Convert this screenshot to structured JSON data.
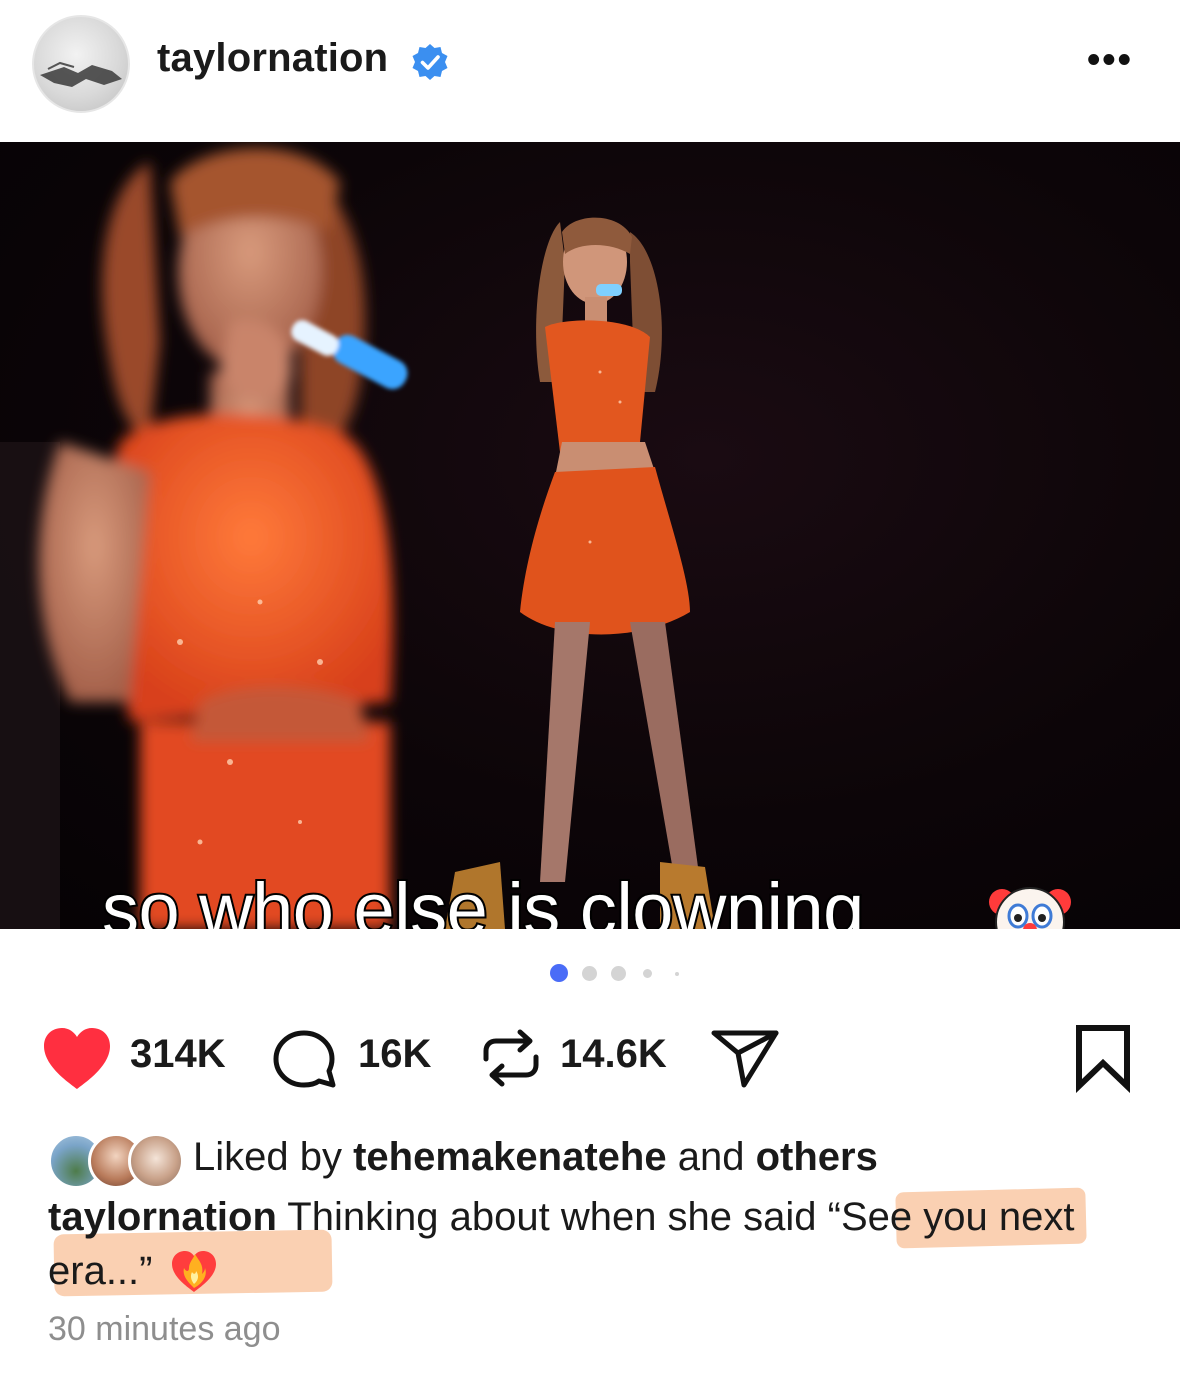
{
  "post": {
    "author": {
      "username": "taylornation",
      "verified": true,
      "avatar_icon": "avatar"
    },
    "more_icon": "more-icon",
    "more_label": "•••",
    "media": {
      "overlay_text": "so who else is clowning",
      "overlay_emoji": "clown-face-emoji",
      "carousel": {
        "total": 5,
        "active_index": 0
      }
    },
    "actions": {
      "like_count": "314K",
      "comment_count": "16K",
      "repost_count": "14.6K",
      "like_icon": "heart-icon",
      "comment_icon": "comment-icon",
      "repost_icon": "repost-icon",
      "share_icon": "share-icon",
      "save_icon": "bookmark-icon"
    },
    "likes": {
      "prefix": "Liked by ",
      "user": "tehemakenatehe",
      "middle": " and ",
      "others": "others"
    },
    "caption": {
      "username": "taylornation",
      "text_part1": " Thinking about when she said ",
      "text_highlight": "“See you next era...”",
      "emoji": "heart-on-fire-emoji"
    },
    "timestamp": "30 minutes ago",
    "colors": {
      "like_red": "#ff2f40",
      "verified_blue": "#3b8ff0",
      "active_dot": "#4a6cf7",
      "highlight": "#f9c8a4",
      "timestamp_gray": "#8e8e8e"
    }
  }
}
